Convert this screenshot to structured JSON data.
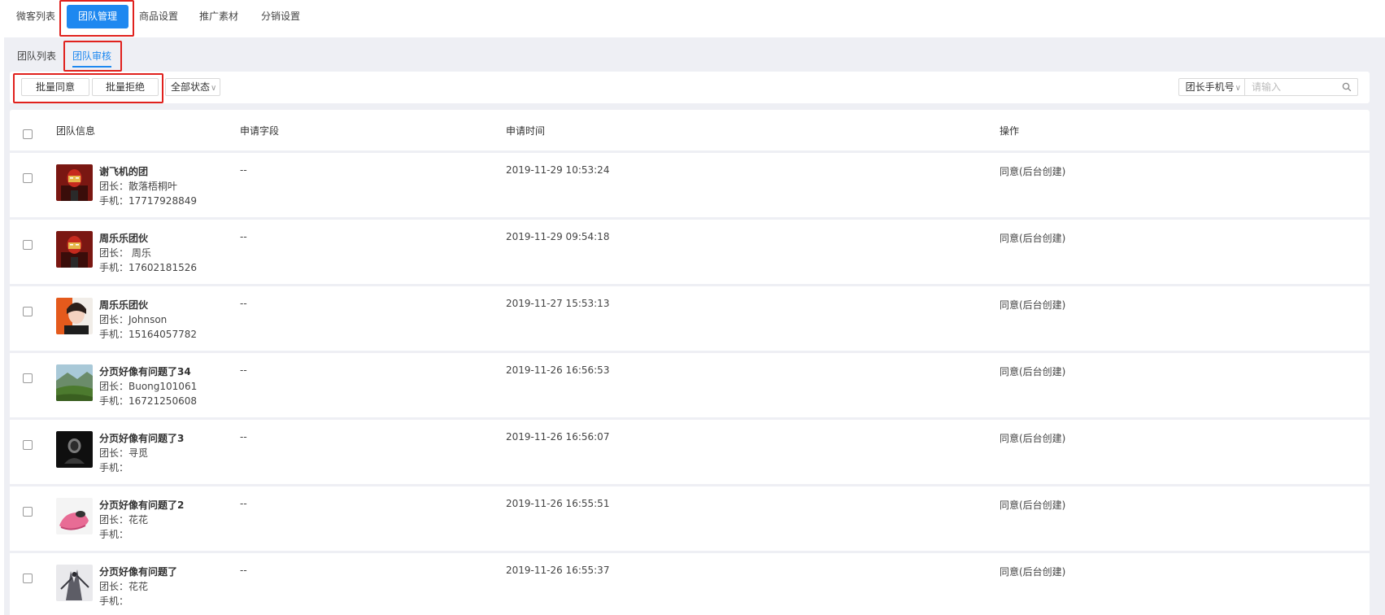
{
  "top_nav": {
    "tabs": [
      {
        "label": "微客列表"
      },
      {
        "label": "团队管理"
      },
      {
        "label": "商品设置"
      },
      {
        "label": "推广素材"
      },
      {
        "label": "分销设置"
      }
    ],
    "active": "团队管理"
  },
  "sub_tabs": {
    "tabs": [
      {
        "label": "团队列表"
      },
      {
        "label": "团队审核"
      }
    ],
    "active": "团队审核"
  },
  "toolbar": {
    "batch_agree_label": "批量同意",
    "batch_reject_label": "批量拒绝",
    "status_filter": "全部状态",
    "search_field": "团长手机号",
    "search_placeholder": "请输入"
  },
  "table": {
    "columns": [
      "团队信息",
      "申请字段",
      "申请时间",
      "操作"
    ],
    "rows": [
      {
        "name": "谢飞机的团",
        "leader": "团长：散落梧桐叶",
        "phone": "手机：17717928849",
        "field": "--",
        "time": "2019-11-29 10:53:24",
        "action": "同意(后台创建)",
        "avatar": "ironman"
      },
      {
        "name": "周乐乐团伙",
        "leader": "团长： 周乐",
        "phone": "手机：17602181526",
        "field": "--",
        "time": "2019-11-29 09:54:18",
        "action": "同意(后台创建)",
        "avatar": "ironman"
      },
      {
        "name": "周乐乐团伙",
        "leader": "团长：Johnson",
        "phone": "手机：15164057782",
        "field": "--",
        "time": "2019-11-27 15:53:13",
        "action": "同意(后台创建)",
        "avatar": "girl"
      },
      {
        "name": "分页好像有问题了34",
        "leader": "团长：Buong101061",
        "phone": "手机：16721250608",
        "field": "--",
        "time": "2019-11-26 16:56:53",
        "action": "同意(后台创建)",
        "avatar": "landscape"
      },
      {
        "name": "分页好像有问题了3",
        "leader": "团长：寻觅",
        "phone": "手机：",
        "field": "--",
        "time": "2019-11-26 16:56:07",
        "action": "同意(后台创建)",
        "avatar": "dark"
      },
      {
        "name": "分页好像有问题了2",
        "leader": "团长：花花",
        "phone": "手机：",
        "field": "--",
        "time": "2019-11-26 16:55:51",
        "action": "同意(后台创建)",
        "avatar": "pink"
      },
      {
        "name": "分页好像有问题了",
        "leader": "团长：花花",
        "phone": "手机：",
        "field": "--",
        "time": "2019-11-26 16:55:37",
        "action": "同意(后台创建)",
        "avatar": "sketch"
      }
    ]
  },
  "colors": {
    "accent": "#1e88f0",
    "highlight": "#e0211d",
    "background": "#eeeff4"
  }
}
